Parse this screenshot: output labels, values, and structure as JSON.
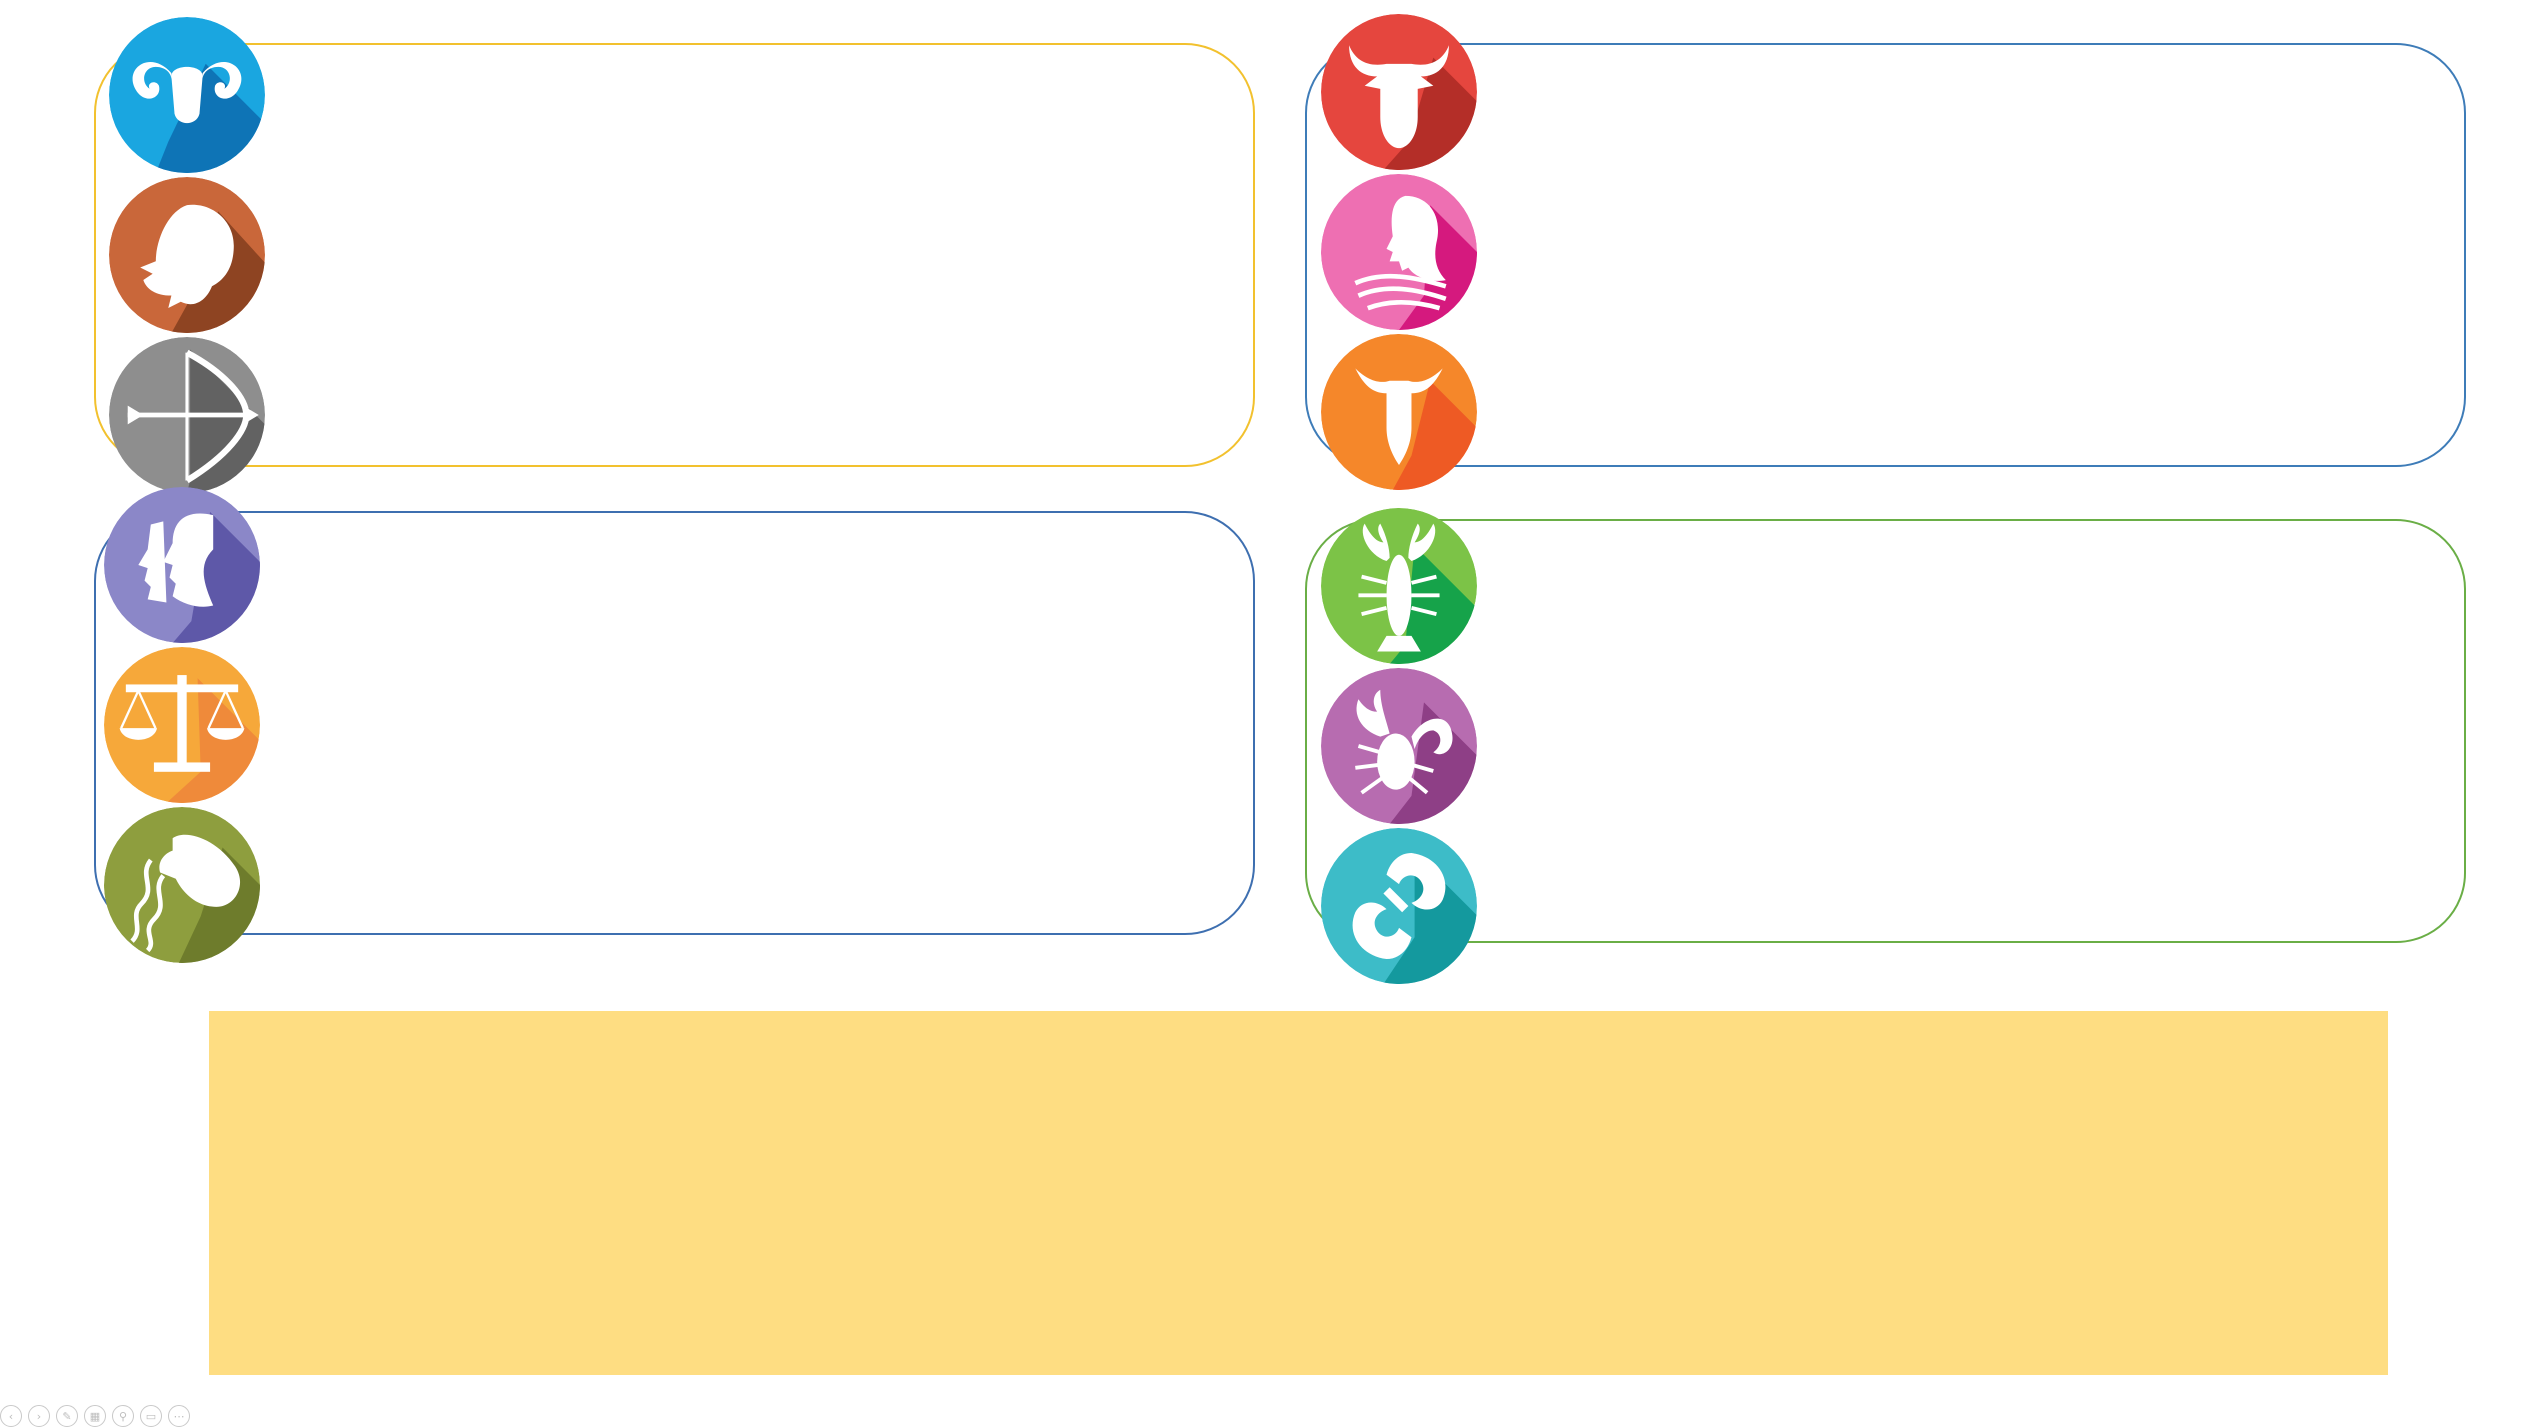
{
  "colors": {
    "fire_border": "#F2C12E",
    "earth_border": "#3E7CB8",
    "air_border": "#3E6FB0",
    "water_border": "#6AAE46",
    "banner_fill": "#FEDD82"
  },
  "groups": [
    {
      "id": "fire",
      "signs": [
        "aries",
        "leo",
        "sagittarius"
      ]
    },
    {
      "id": "earth",
      "signs": [
        "taurus",
        "virgo",
        "capricorn"
      ]
    },
    {
      "id": "air",
      "signs": [
        "gemini",
        "libra",
        "aquarius"
      ]
    },
    {
      "id": "water",
      "signs": [
        "cancer",
        "scorpio",
        "pisces"
      ]
    }
  ],
  "signs": {
    "aries": {
      "icon": "ram-head-icon",
      "color": "#1AA6E0",
      "shade": "#0E74B6"
    },
    "leo": {
      "icon": "lion-head-icon",
      "color": "#C9673A",
      "shade": "#8E4422"
    },
    "sagittarius": {
      "icon": "bow-and-arrow-icon",
      "color": "#8E8E8E",
      "shade": "#626262"
    },
    "gemini": {
      "icon": "twin-faces-icon",
      "color": "#8B87C8",
      "shade": "#5E58A8"
    },
    "libra": {
      "icon": "balance-scale-icon",
      "color": "#F6A83A",
      "shade": "#EF8A3A"
    },
    "aquarius": {
      "icon": "water-jug-icon",
      "color": "#8E9E3E",
      "shade": "#6E7C2C"
    },
    "taurus": {
      "icon": "bull-head-icon",
      "color": "#E5463E",
      "shade": "#B42E28"
    },
    "virgo": {
      "icon": "maiden-profile-icon",
      "color": "#EE6FB2",
      "shade": "#D5197E"
    },
    "capricorn": {
      "icon": "goat-head-icon",
      "color": "#F5872A",
      "shade": "#EE5A24"
    },
    "cancer": {
      "icon": "crayfish-icon",
      "color": "#7CC347",
      "shade": "#16A34A"
    },
    "scorpio": {
      "icon": "scorpion-icon",
      "color": "#B76CB0",
      "shade": "#8E3F86"
    },
    "pisces": {
      "icon": "two-fish-icon",
      "color": "#3DBCC8",
      "shade": "#14999E"
    }
  },
  "toolbar": {
    "icons": [
      "previous-slide-icon",
      "next-slide-icon",
      "pen-icon",
      "slides-grid-icon",
      "zoom-icon",
      "subtitles-icon",
      "more-options-icon"
    ],
    "glyphs": [
      "‹",
      "›",
      "✎",
      "▦",
      "⚲",
      "▭",
      "⋯"
    ]
  }
}
